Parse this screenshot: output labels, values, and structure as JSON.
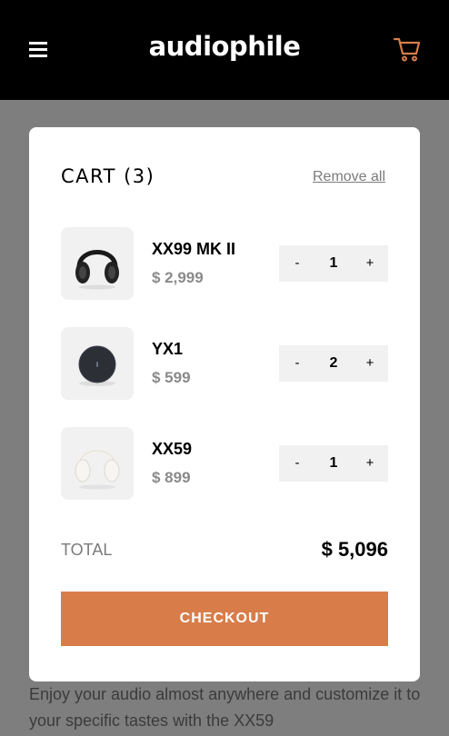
{
  "header": {
    "logo": "audiophile",
    "menu_icon": "hamburger-menu-icon",
    "cart_icon": "shopping-cart-icon",
    "accent_color": "#d87d4a"
  },
  "cart": {
    "title": "CART (3)",
    "remove_all": "Remove all",
    "items": [
      {
        "name": "XX99 MK II",
        "price": "$ 2,999",
        "qty": "1",
        "minus": "-",
        "plus": "+",
        "image": "black-headphones"
      },
      {
        "name": "YX1",
        "price": "$ 599",
        "qty": "2",
        "minus": "-",
        "plus": "+",
        "image": "black-earbuds-case"
      },
      {
        "name": "XX59",
        "price": "$ 899",
        "qty": "1",
        "minus": "-",
        "plus": "+",
        "image": "white-headphones"
      }
    ],
    "total_label": "TOTAL",
    "total_value": "$ 5,096",
    "checkout": "CHECKOUT"
  },
  "background": {
    "text": "Enjoy your audio almost anywhere and customize it to your specific tastes with the XX59"
  }
}
